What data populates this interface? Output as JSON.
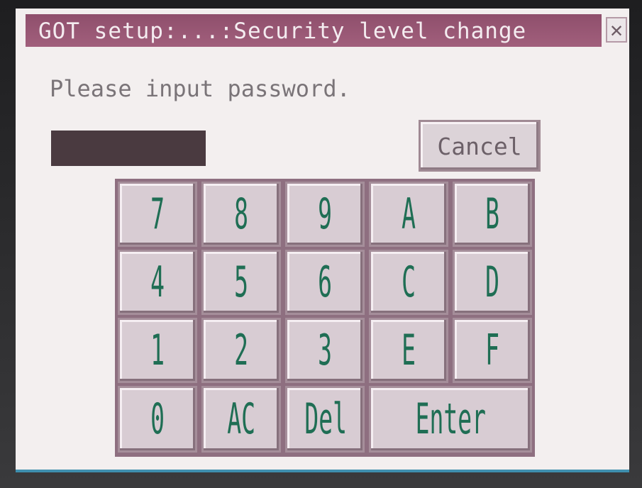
{
  "dialog": {
    "title": "GOT setup:...:Security level change",
    "close_glyph": "✕",
    "prompt": "Please input password.",
    "password_value": "",
    "cancel_label": "Cancel"
  },
  "keypad": {
    "rows": [
      [
        "7",
        "8",
        "9",
        "A",
        "B"
      ],
      [
        "4",
        "5",
        "6",
        "C",
        "D"
      ],
      [
        "1",
        "2",
        "3",
        "E",
        "F"
      ],
      [
        "0",
        "AC",
        "Del",
        "Enter"
      ]
    ]
  },
  "colors": {
    "titlebar": "#9a5a77",
    "key_text": "#1f6e54",
    "screen_bg": "#f3efef"
  }
}
